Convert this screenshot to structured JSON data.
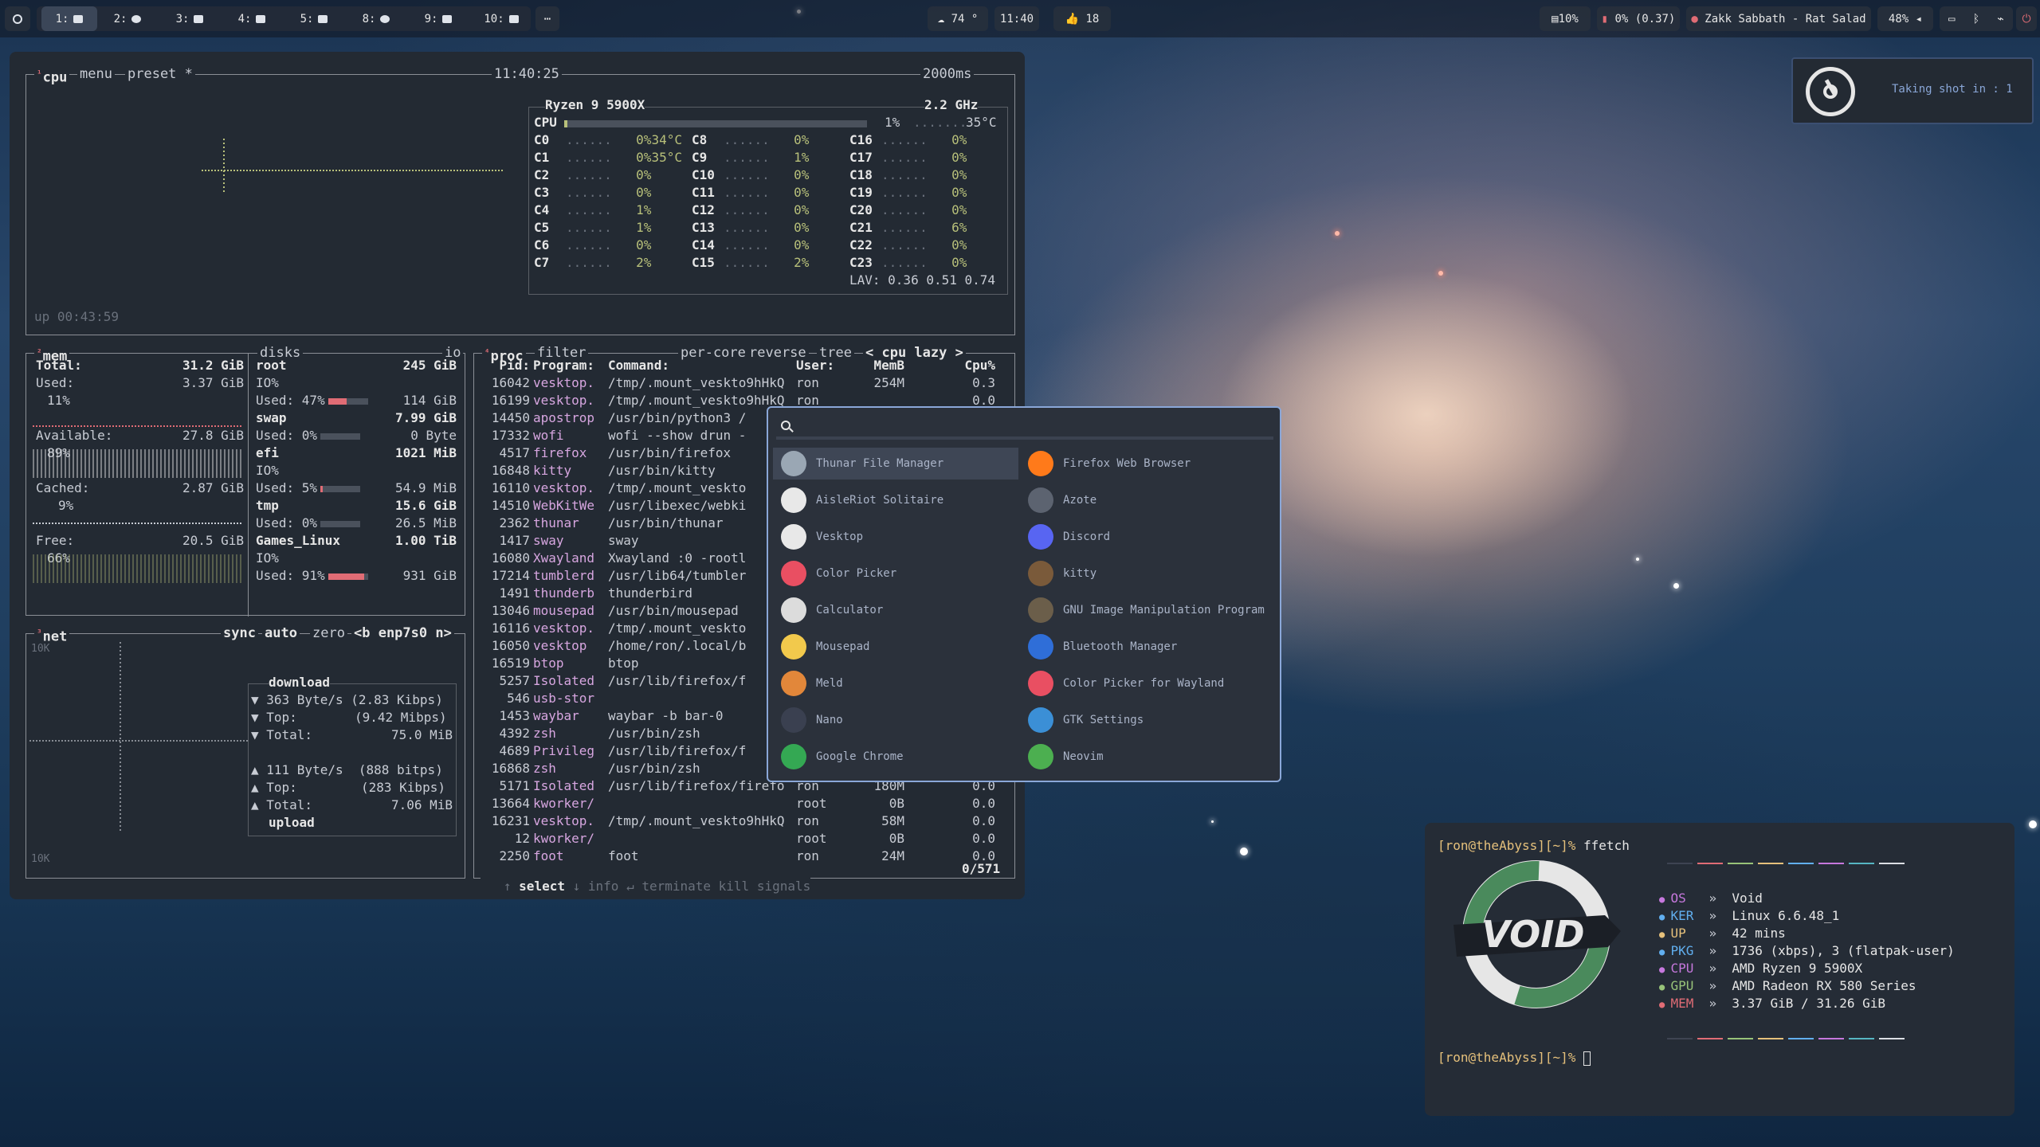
{
  "topbar": {
    "workspaces": [
      {
        "label": "1:",
        "active": true
      },
      {
        "label": "2:"
      },
      {
        "label": "3:"
      },
      {
        "label": "4:"
      },
      {
        "label": "5:"
      },
      {
        "label": "8:"
      },
      {
        "label": "9:"
      },
      {
        "label": "10:"
      }
    ],
    "weather": "74 °",
    "clock": "11:40",
    "updates": "18",
    "memory": "10%",
    "cpu_load": "0% (0.37)",
    "media": "Zakk Sabbath - Rat Salad",
    "volume": "48%"
  },
  "btop": {
    "cpu_header": {
      "cpu": "cpu",
      "menu": "menu",
      "preset": "preset *",
      "time": "11:40:25",
      "interval": "2000ms"
    },
    "cpu_model": "Ryzen 9 5900X",
    "cpu_freq": "2.2 GHz",
    "cpu_total": {
      "label": "CPU",
      "pct": "1%",
      "temp": "35°C",
      "fill": 0.01
    },
    "cores": [
      {
        "name": "C0",
        "pct": "0%",
        "temp": "34°C"
      },
      {
        "name": "C1",
        "pct": "0%",
        "temp": "35°C"
      },
      {
        "name": "C2",
        "pct": "0%"
      },
      {
        "name": "C3",
        "pct": "0%"
      },
      {
        "name": "C4",
        "pct": "1%"
      },
      {
        "name": "C5",
        "pct": "1%"
      },
      {
        "name": "C6",
        "pct": "0%"
      },
      {
        "name": "C7",
        "pct": "2%"
      },
      {
        "name": "C8",
        "pct": "0%"
      },
      {
        "name": "C9",
        "pct": "1%"
      },
      {
        "name": "C10",
        "pct": "0%"
      },
      {
        "name": "C11",
        "pct": "0%"
      },
      {
        "name": "C12",
        "pct": "0%"
      },
      {
        "name": "C13",
        "pct": "0%"
      },
      {
        "name": "C14",
        "pct": "0%"
      },
      {
        "name": "C15",
        "pct": "2%"
      },
      {
        "name": "C16",
        "pct": "0%"
      },
      {
        "name": "C17",
        "pct": "0%"
      },
      {
        "name": "C18",
        "pct": "0%"
      },
      {
        "name": "C19",
        "pct": "0%"
      },
      {
        "name": "C20",
        "pct": "0%"
      },
      {
        "name": "C21",
        "pct": "6%"
      },
      {
        "name": "C22",
        "pct": "0%"
      },
      {
        "name": "C23",
        "pct": "0%"
      }
    ],
    "lav": "LAV: 0.36 0.51 0.74",
    "uptime": "up 00:43:59",
    "mem": {
      "title": "mem",
      "total_label": "Total:",
      "total": "31.2 GiB",
      "used_label": "Used:",
      "used": "3.37 GiB",
      "used_pct": "11%",
      "available_label": "Available:",
      "available": "27.8 GiB",
      "available_pct": "89%",
      "cached_label": "Cached:",
      "cached": "2.87 GiB",
      "cached_pct": "9%",
      "free_label": "Free:",
      "free": "20.5 GiB",
      "free_pct": "66%"
    },
    "disks": {
      "title": "disks",
      "io": "io",
      "items": [
        {
          "name": "root",
          "size": "245 GiB",
          "io": "IO%",
          "used_pct": "47%",
          "used_fill": 0.47,
          "used": "114 GiB"
        },
        {
          "name": "swap",
          "size": "7.99 GiB",
          "used_pct": "0%",
          "used_fill": 0,
          "used": "0 Byte"
        },
        {
          "name": "efi",
          "size": "1021 MiB",
          "io": "IO%",
          "used_pct": "5%",
          "used_fill": 0.05,
          "used": "54.9 MiB"
        },
        {
          "name": "tmp",
          "size": "15.6 GiB",
          "used_pct": "0%",
          "used_fill": 0,
          "used": "26.5 MiB"
        },
        {
          "name": "Games_Linux",
          "size": "1.00 TiB",
          "io": "IO%",
          "used_pct": "91%",
          "used_fill": 0.91,
          "used": "931 GiB"
        }
      ]
    },
    "net": {
      "title": "net",
      "sync": "sync",
      "auto": "auto",
      "zero": "zero",
      "iface": "<b enp7s0 n>",
      "scale_top": "10K",
      "scale_bottom": "10K",
      "download": "download",
      "dl_rate": "363 Byte/s (2.83 Kibps)",
      "dl_top": "(9.42 Mibps)",
      "dl_total": "75.0 MiB",
      "ul_rate": "111 Byte/s  (888 bitps)",
      "ul_top": "(283 Kibps)",
      "ul_total": "7.06 MiB",
      "upload": "upload",
      "top_label": "Top:",
      "total_label": "Total:"
    },
    "proc": {
      "title": "proc",
      "filter": "filter",
      "percore": "per-core",
      "reverse": "reverse",
      "tree": "tree",
      "sort": "< cpu lazy >",
      "headers": [
        "Pid:",
        "Program:",
        "Command:",
        "User:",
        "MemB",
        "Cpu%"
      ],
      "rows": [
        [
          "16042",
          "vesktop.",
          "/tmp/.mount_veskto9hHkQ",
          "ron",
          "254M",
          "0.3"
        ],
        [
          "16199",
          "vesktop.",
          "/tmp/.mount_veskto9hHkQ",
          "ron",
          "",
          "0.0"
        ],
        [
          "14450",
          "apostrop",
          "/usr/bin/python3 /",
          "",
          "",
          ""
        ],
        [
          "17332",
          "wofi",
          "wofi --show drun -",
          "",
          "",
          ""
        ],
        [
          "4517",
          "firefox",
          "/usr/bin/firefox",
          "",
          "",
          ""
        ],
        [
          "16848",
          "kitty",
          "/usr/bin/kitty",
          "",
          "",
          ""
        ],
        [
          "16110",
          "vesktop.",
          "/tmp/.mount_veskto",
          "",
          "",
          ""
        ],
        [
          "14510",
          "WebKitWe",
          "/usr/libexec/webki",
          "",
          "",
          ""
        ],
        [
          "2362",
          "thunar",
          "/usr/bin/thunar",
          "",
          "",
          ""
        ],
        [
          "1417",
          "sway",
          "sway",
          "",
          "",
          ""
        ],
        [
          "16080",
          "Xwayland",
          "Xwayland :0 -rootl",
          "",
          "",
          ""
        ],
        [
          "17214",
          "tumblerd",
          "/usr/lib64/tumbler",
          "",
          "",
          ""
        ],
        [
          "1491",
          "thunderb",
          "thunderbird",
          "",
          "",
          ""
        ],
        [
          "13046",
          "mousepad",
          "/usr/bin/mousepad",
          "",
          "",
          ""
        ],
        [
          "16116",
          "vesktop.",
          "/tmp/.mount_veskto",
          "",
          "",
          ""
        ],
        [
          "16050",
          "vesktop",
          "/home/ron/.local/b",
          "",
          "",
          ""
        ],
        [
          "16519",
          "btop",
          "btop",
          "",
          "",
          ""
        ],
        [
          "5257",
          "Isolated",
          "/usr/lib/firefox/f",
          "",
          "",
          ""
        ],
        [
          "546",
          "usb-stor",
          "",
          "",
          "",
          ""
        ],
        [
          "1453",
          "waybar",
          "waybar -b bar-0",
          "",
          "",
          ""
        ],
        [
          "4392",
          "zsh",
          "/usr/bin/zsh",
          "",
          "",
          ""
        ],
        [
          "4689",
          "Privileg",
          "/usr/lib/firefox/f",
          "",
          "",
          ""
        ],
        [
          "16868",
          "zsh",
          "/usr/bin/zsh",
          "",
          "",
          ""
        ],
        [
          "5171",
          "Isolated",
          "/usr/lib/firefox/firefo",
          "ron",
          "180M",
          "0.0"
        ],
        [
          "13664",
          "kworker/",
          "",
          "root",
          "0B",
          "0.0"
        ],
        [
          "16231",
          "vesktop.",
          "/tmp/.mount_veskto9hHkQ",
          "ron",
          "58M",
          "0.0"
        ],
        [
          "12",
          "kworker/",
          "",
          "root",
          "0B",
          "0.0"
        ],
        [
          "2250",
          "foot",
          "foot",
          "ron",
          "24M",
          "0.0"
        ]
      ],
      "footer": {
        "select": "select",
        "info": "info",
        "terminate": "terminate",
        "kill": "kill",
        "signals": "signals",
        "count": "0/571"
      }
    }
  },
  "launcher": {
    "apps": [
      {
        "name": "Thunar File Manager",
        "icon": "folder-icon",
        "color": "#9aa7b4",
        "selected": true
      },
      {
        "name": "Firefox Web Browser",
        "icon": "firefox-icon",
        "color": "#ff7a1a"
      },
      {
        "name": "AisleRiot Solitaire",
        "icon": "cards-icon",
        "color": "#e8e8e8"
      },
      {
        "name": "Azote",
        "icon": "azote-icon",
        "color": "#5c6370"
      },
      {
        "name": "Vesktop",
        "icon": "vesktop-icon",
        "color": "#e8e8e8"
      },
      {
        "name": "Discord",
        "icon": "discord-icon",
        "color": "#5865f2"
      },
      {
        "name": "Color Picker",
        "icon": "color-wheel-icon",
        "color": "#e94f62"
      },
      {
        "name": "kitty",
        "icon": "kitty-cat-icon",
        "color": "#7a5a3a"
      },
      {
        "name": "Calculator",
        "icon": "calculator-icon",
        "color": "#dcdcdc"
      },
      {
        "name": "GNU Image Manipulation Program",
        "icon": "gimp-icon",
        "color": "#6b5e4a"
      },
      {
        "name": "Mousepad",
        "icon": "notepad-icon",
        "color": "#f2c94c"
      },
      {
        "name": "Bluetooth Manager",
        "icon": "bluetooth-icon",
        "color": "#2f6ed8"
      },
      {
        "name": "Meld",
        "icon": "meld-icon",
        "color": "#e2873a"
      },
      {
        "name": "Color Picker for Wayland",
        "icon": "color-wheel-icon",
        "color": "#e94f62"
      },
      {
        "name": "Nano",
        "icon": "nano-icon",
        "color": "#3a4050"
      },
      {
        "name": "GTK Settings",
        "icon": "gtk-settings-icon",
        "color": "#3b8fd6"
      },
      {
        "name": "Google Chrome",
        "icon": "chrome-icon",
        "color": "#34a853"
      },
      {
        "name": "Neovim",
        "icon": "neovim-icon",
        "color": "#4caf50"
      }
    ]
  },
  "notification": {
    "text": "Taking shot in : 1"
  },
  "fetch": {
    "prompt": "[ron@theAbyss][~]%",
    "command": "ffetch",
    "logo_text": "VOID",
    "info": [
      {
        "key": "OS",
        "value": "Void",
        "color": "#c678dd"
      },
      {
        "key": "KER",
        "value": "Linux 6.6.48_1",
        "color": "#61afef"
      },
      {
        "key": "UP",
        "value": "42 mins",
        "color": "#e5c07b"
      },
      {
        "key": "PKG",
        "value": "1736 (xbps), 3 (flatpak-user)",
        "color": "#61afef"
      },
      {
        "key": "CPU",
        "value": "AMD Ryzen 9 5900X",
        "color": "#c678dd"
      },
      {
        "key": "GPU",
        "value": "AMD Radeon RX 580 Series",
        "color": "#98c379"
      },
      {
        "key": "MEM",
        "value": "3.37 GiB / 31.26 GiB",
        "color": "#e06c75"
      }
    ],
    "palette": [
      "#3e4452",
      "#e06c75",
      "#98c379",
      "#e5c07b",
      "#61afef",
      "#c678dd",
      "#56b6c2",
      "#dcdfe4"
    ]
  }
}
